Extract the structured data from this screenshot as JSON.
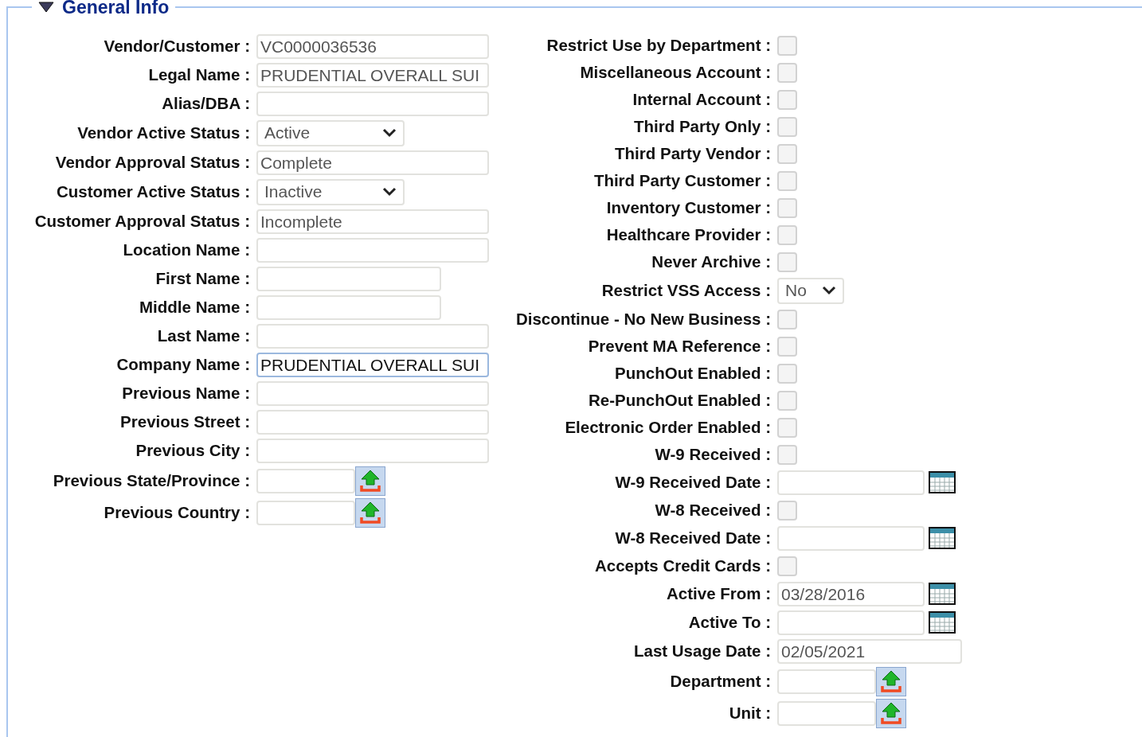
{
  "section": {
    "title": "General Info",
    "expanded": true
  },
  "left_fields": [
    {
      "label": "Vendor/Customer :",
      "kind": "text",
      "value": "VC0000036536",
      "focused": false
    },
    {
      "label": "Legal Name :",
      "kind": "text",
      "value": "PRUDENTIAL OVERALL SUI",
      "focused": false
    },
    {
      "label": "Alias/DBA :",
      "kind": "text",
      "focused": false
    },
    {
      "label": "Vendor Active Status :",
      "kind": "select",
      "value": "Active"
    },
    {
      "label": "Vendor Approval Status :",
      "kind": "text",
      "value": "Complete",
      "focused": false
    },
    {
      "label": "Customer Active Status :",
      "kind": "select",
      "value": "Inactive"
    },
    {
      "label": "Customer Approval Status :",
      "kind": "text",
      "value": "Incomplete",
      "focused": false
    },
    {
      "label": "Location Name :",
      "kind": "text",
      "focused": false
    },
    {
      "label": "First Name :",
      "kind": "short",
      "focused": false
    },
    {
      "label": "Middle Name :",
      "kind": "short",
      "focused": false
    },
    {
      "label": "Last Name :",
      "kind": "text",
      "focused": false
    },
    {
      "label": "Company Name :",
      "kind": "text",
      "value": "PRUDENTIAL OVERALL SUI",
      "focused": true
    },
    {
      "label": "Previous Name :",
      "kind": "text",
      "focused": false
    },
    {
      "label": "Previous Street :",
      "kind": "text",
      "focused": false
    },
    {
      "label": "Previous City :",
      "kind": "text",
      "focused": false
    },
    {
      "label": "Previous State/Province :",
      "kind": "lookup"
    },
    {
      "label": "Previous Country :",
      "kind": "lookup"
    }
  ],
  "right_fields": [
    {
      "label": "Restrict Use by Department :",
      "kind": "checkbox",
      "checked": false
    },
    {
      "label": "Miscellaneous Account :",
      "kind": "checkbox",
      "checked": false
    },
    {
      "label": "Internal Account :",
      "kind": "checkbox",
      "checked": false
    },
    {
      "label": "Third Party Only :",
      "kind": "checkbox",
      "checked": false
    },
    {
      "label": "Third Party Vendor :",
      "kind": "checkbox",
      "checked": false
    },
    {
      "label": "Third Party Customer :",
      "kind": "checkbox",
      "checked": false
    },
    {
      "label": "Inventory Customer :",
      "kind": "checkbox",
      "checked": false
    },
    {
      "label": "Healthcare Provider :",
      "kind": "checkbox",
      "checked": false
    },
    {
      "label": "Never Archive :",
      "kind": "checkbox",
      "checked": false
    },
    {
      "label": "Restrict VSS Access :",
      "kind": "small_select",
      "value": "No"
    },
    {
      "label": "Discontinue - No New Business :",
      "kind": "checkbox",
      "checked": false
    },
    {
      "label": "Prevent MA Reference :",
      "kind": "checkbox",
      "checked": false
    },
    {
      "label": "PunchOut Enabled :",
      "kind": "checkbox",
      "checked": false
    },
    {
      "label": "Re-PunchOut Enabled :",
      "kind": "checkbox",
      "checked": false
    },
    {
      "label": "Electronic Order Enabled :",
      "kind": "checkbox",
      "checked": false
    },
    {
      "label": "W-9 Received :",
      "kind": "checkbox",
      "checked": false
    },
    {
      "label": "W-9 Received Date :",
      "kind": "date"
    },
    {
      "label": "W-8 Received :",
      "kind": "checkbox",
      "checked": false
    },
    {
      "label": "W-8 Received Date :",
      "kind": "date"
    },
    {
      "label": "Accepts Credit Cards :",
      "kind": "checkbox",
      "checked": false
    },
    {
      "label": "Active From :",
      "kind": "date",
      "value": "03/28/2016"
    },
    {
      "label": "Active To :",
      "kind": "date"
    },
    {
      "label": "Last Usage Date :",
      "kind": "short",
      "value": "02/05/2021",
      "focused": false
    },
    {
      "label": "Department :",
      "kind": "lookup"
    },
    {
      "label": "Unit :",
      "kind": "lookup"
    }
  ]
}
